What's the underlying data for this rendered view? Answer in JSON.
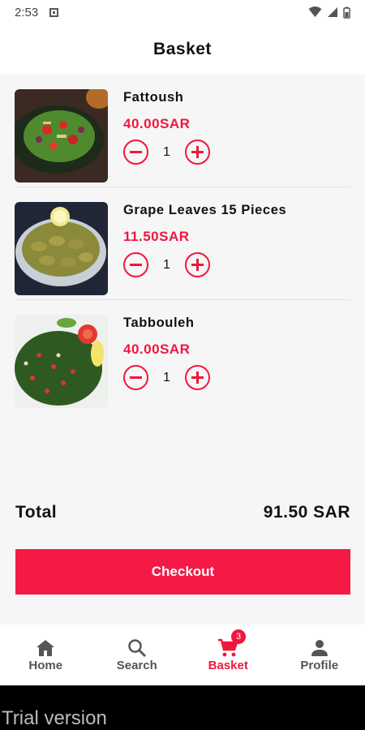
{
  "status_bar": {
    "time": "2:53"
  },
  "header": {
    "title": "Basket"
  },
  "items": [
    {
      "name": "Fattoush",
      "price": "40.00SAR",
      "quantity": "1"
    },
    {
      "name": "Grape Leaves 15 Pieces",
      "price": "11.50SAR",
      "quantity": "1"
    },
    {
      "name": "Tabbouleh",
      "price": "40.00SAR",
      "quantity": "1"
    }
  ],
  "summary": {
    "total_label": "Total",
    "total_value": "91.50 SAR"
  },
  "checkout": {
    "label": "Checkout"
  },
  "nav": {
    "items": [
      {
        "label": "Home",
        "icon": "home-icon"
      },
      {
        "label": "Search",
        "icon": "search-icon"
      },
      {
        "label": "Basket",
        "icon": "cart-icon",
        "badge": "3",
        "active": true
      },
      {
        "label": "Profile",
        "icon": "person-icon"
      }
    ]
  },
  "watermark": {
    "text": "Trial version"
  },
  "colors": {
    "accent": "#f0173f",
    "checkout_bg": "#f51a45"
  }
}
